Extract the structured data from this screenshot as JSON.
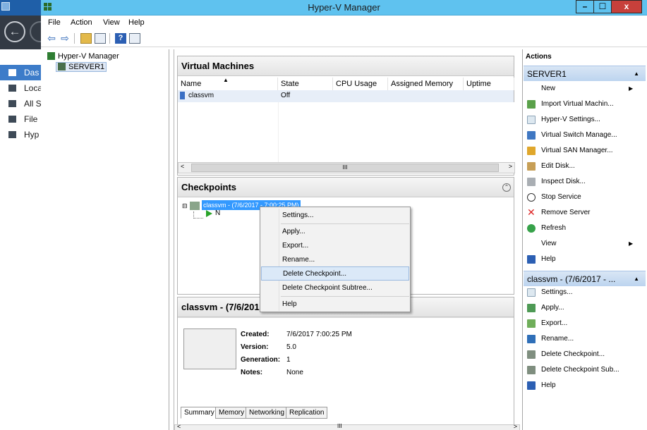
{
  "background_window": {
    "nav_items": [
      "Das",
      "Loca",
      "All S",
      "File",
      "Hyp"
    ]
  },
  "window": {
    "title": "Hyper-V Manager",
    "controls": {
      "minimize": "–",
      "maximize": "☐",
      "close": "x"
    }
  },
  "menu": [
    "File",
    "Action",
    "View",
    "Help"
  ],
  "toolbar": {
    "back": "⇦",
    "forward": "⇨",
    "help": "?"
  },
  "tree": {
    "root": "Hyper-V Manager",
    "server": "SERVER1"
  },
  "vm_panel": {
    "title": "Virtual Machines",
    "columns": [
      "Name",
      "State",
      "CPU Usage",
      "Assigned Memory",
      "Uptime"
    ],
    "sort_indicator": "▲",
    "rows": [
      {
        "name": "classvm",
        "state": "Off",
        "cpu": "",
        "memory": "",
        "uptime": ""
      }
    ],
    "scroll_left": "<",
    "scroll_right": ">",
    "scroll_grip": "III"
  },
  "checkpoints_panel": {
    "title": "Checkpoints",
    "collapse_glyph": "⌃",
    "expander": "⊟",
    "checkpoint_label": "classvm - (7/6/2017 - 7:00:25 PM)",
    "now_label": "N"
  },
  "details_panel": {
    "title": "classvm - (7/6/2017 - 7:00:25 PM)",
    "fields": [
      {
        "key": "Created:",
        "value": "7/6/2017 7:00:25 PM"
      },
      {
        "key": "Version:",
        "value": "5.0"
      },
      {
        "key": "Generation:",
        "value": "1"
      },
      {
        "key": "Notes:",
        "value": "None"
      }
    ],
    "tabs": [
      "Summary",
      "Memory",
      "Networking",
      "Replication"
    ]
  },
  "bottom_scroll": {
    "left": "<",
    "right": ">",
    "grip": "III"
  },
  "context_menu": {
    "items": [
      "Settings...",
      "Apply...",
      "Export...",
      "Rename...",
      "Delete Checkpoint...",
      "Delete Checkpoint Subtree...",
      "Help"
    ],
    "highlighted": "Delete Checkpoint..."
  },
  "actions": {
    "title": "Actions",
    "server_group": {
      "label": "SERVER1",
      "items": [
        "New",
        "Import Virtual Machin...",
        "Hyper-V Settings...",
        "Virtual Switch Manage...",
        "Virtual SAN Manager...",
        "Edit Disk...",
        "Inspect Disk...",
        "Stop Service",
        "Remove Server",
        "Refresh",
        "View",
        "Help"
      ]
    },
    "checkpoint_group": {
      "label": "classvm - (7/6/2017 - ...",
      "items": [
        "Settings...",
        "Apply...",
        "Export...",
        "Rename...",
        "Delete Checkpoint...",
        "Delete Checkpoint Sub...",
        "Help"
      ]
    },
    "submenu_arrow": "▶",
    "group_arrow": "▲"
  },
  "colors": {
    "title_bar": "#5fc2ef",
    "selection": "#3399ff",
    "action_group": "#bcd4ef",
    "close_button": "#c7403b"
  }
}
